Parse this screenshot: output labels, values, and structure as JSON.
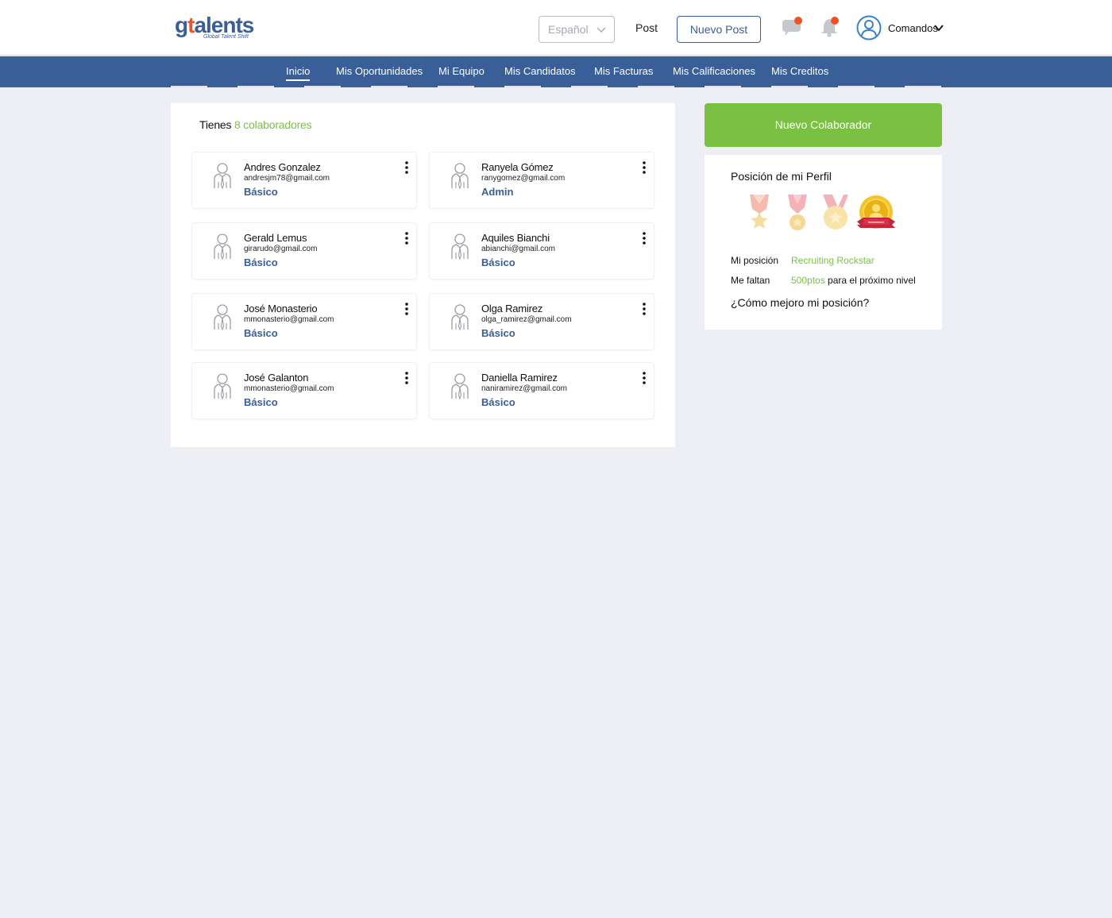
{
  "brand": {
    "logo_main": "g",
    "logo_tie": "t",
    "logo_rest": "alents",
    "logo_sub": "Global Talent Shift"
  },
  "header": {
    "language": "Español",
    "post_label": "Post",
    "new_post_label": "Nuevo Post",
    "user_name": "Comandos",
    "notification_color": "#f05023"
  },
  "nav": {
    "items": [
      {
        "label": "Inicio",
        "active": true
      },
      {
        "label": "Mis Oportunidades"
      },
      {
        "label": "Mi Equipo"
      },
      {
        "label": "Mis Candidatos"
      },
      {
        "label": "Mis Facturas"
      },
      {
        "label": "Mis Calificaciones"
      },
      {
        "label": "Mis Creditos"
      }
    ]
  },
  "team": {
    "title_prefix": "Tienes",
    "title_count": "8 colaboradores",
    "collaborators": [
      {
        "name": "Andres Gonzalez",
        "email": "andresjm78@gmail.com",
        "role": "Básico"
      },
      {
        "name": "Ranyela Gómez",
        "email": "ranygomez@gmail.com",
        "role": "Admin"
      },
      {
        "name": "Gerald Lemus",
        "email": "girarudo@gmail.com",
        "role": "Básico"
      },
      {
        "name": "Aquiles Bianchi",
        "email": "abianchi@gmail.com",
        "role": "Básico"
      },
      {
        "name": "José Monasterio",
        "email": "mmonasterio@gmail.com",
        "role": "Básico"
      },
      {
        "name": "Olga Ramirez",
        "email": "olga_ramirez@gmail.com",
        "role": "Básico"
      },
      {
        "name": "José Galanton",
        "email": "mmonasterio@gmail.com",
        "role": "Básico"
      },
      {
        "name": "Daniella Ramirez",
        "email": "naniramirez@gmail.com",
        "role": "Básico"
      }
    ]
  },
  "sidebar": {
    "new_collab_label": "Nuevo Colaborador",
    "profile_title": "Posición de mi Perfil",
    "position_label": "Mi posición",
    "position_value": "Recruiting Rockstar",
    "missing_label": "Me faltan",
    "missing_points": "500ptos",
    "missing_suffix": "para el próximo nivel",
    "improve_link": "¿Cómo mejoro mi posición?"
  },
  "colors": {
    "primary": "#3a5e97",
    "accent_green": "#7ac143",
    "background": "#eeeff4"
  }
}
